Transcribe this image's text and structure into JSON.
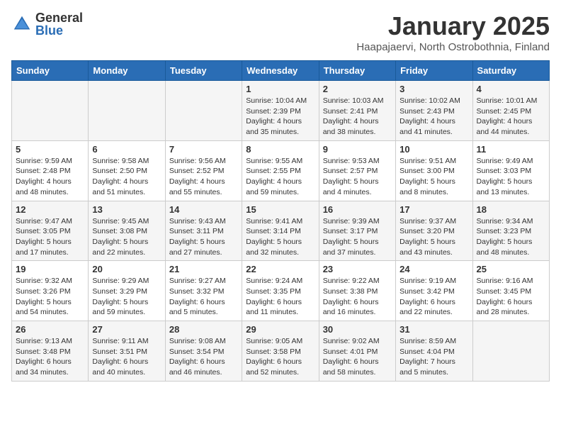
{
  "logo": {
    "general": "General",
    "blue": "Blue"
  },
  "title": "January 2025",
  "subtitle": "Haapajaervi, North Ostrobothnia, Finland",
  "days_of_week": [
    "Sunday",
    "Monday",
    "Tuesday",
    "Wednesday",
    "Thursday",
    "Friday",
    "Saturday"
  ],
  "weeks": [
    [
      {
        "day": "",
        "info": ""
      },
      {
        "day": "",
        "info": ""
      },
      {
        "day": "",
        "info": ""
      },
      {
        "day": "1",
        "info": "Sunrise: 10:04 AM\nSunset: 2:39 PM\nDaylight: 4 hours and 35 minutes."
      },
      {
        "day": "2",
        "info": "Sunrise: 10:03 AM\nSunset: 2:41 PM\nDaylight: 4 hours and 38 minutes."
      },
      {
        "day": "3",
        "info": "Sunrise: 10:02 AM\nSunset: 2:43 PM\nDaylight: 4 hours and 41 minutes."
      },
      {
        "day": "4",
        "info": "Sunrise: 10:01 AM\nSunset: 2:45 PM\nDaylight: 4 hours and 44 minutes."
      }
    ],
    [
      {
        "day": "5",
        "info": "Sunrise: 9:59 AM\nSunset: 2:48 PM\nDaylight: 4 hours and 48 minutes."
      },
      {
        "day": "6",
        "info": "Sunrise: 9:58 AM\nSunset: 2:50 PM\nDaylight: 4 hours and 51 minutes."
      },
      {
        "day": "7",
        "info": "Sunrise: 9:56 AM\nSunset: 2:52 PM\nDaylight: 4 hours and 55 minutes."
      },
      {
        "day": "8",
        "info": "Sunrise: 9:55 AM\nSunset: 2:55 PM\nDaylight: 4 hours and 59 minutes."
      },
      {
        "day": "9",
        "info": "Sunrise: 9:53 AM\nSunset: 2:57 PM\nDaylight: 5 hours and 4 minutes."
      },
      {
        "day": "10",
        "info": "Sunrise: 9:51 AM\nSunset: 3:00 PM\nDaylight: 5 hours and 8 minutes."
      },
      {
        "day": "11",
        "info": "Sunrise: 9:49 AM\nSunset: 3:03 PM\nDaylight: 5 hours and 13 minutes."
      }
    ],
    [
      {
        "day": "12",
        "info": "Sunrise: 9:47 AM\nSunset: 3:05 PM\nDaylight: 5 hours and 17 minutes."
      },
      {
        "day": "13",
        "info": "Sunrise: 9:45 AM\nSunset: 3:08 PM\nDaylight: 5 hours and 22 minutes."
      },
      {
        "day": "14",
        "info": "Sunrise: 9:43 AM\nSunset: 3:11 PM\nDaylight: 5 hours and 27 minutes."
      },
      {
        "day": "15",
        "info": "Sunrise: 9:41 AM\nSunset: 3:14 PM\nDaylight: 5 hours and 32 minutes."
      },
      {
        "day": "16",
        "info": "Sunrise: 9:39 AM\nSunset: 3:17 PM\nDaylight: 5 hours and 37 minutes."
      },
      {
        "day": "17",
        "info": "Sunrise: 9:37 AM\nSunset: 3:20 PM\nDaylight: 5 hours and 43 minutes."
      },
      {
        "day": "18",
        "info": "Sunrise: 9:34 AM\nSunset: 3:23 PM\nDaylight: 5 hours and 48 minutes."
      }
    ],
    [
      {
        "day": "19",
        "info": "Sunrise: 9:32 AM\nSunset: 3:26 PM\nDaylight: 5 hours and 54 minutes."
      },
      {
        "day": "20",
        "info": "Sunrise: 9:29 AM\nSunset: 3:29 PM\nDaylight: 5 hours and 59 minutes."
      },
      {
        "day": "21",
        "info": "Sunrise: 9:27 AM\nSunset: 3:32 PM\nDaylight: 6 hours and 5 minutes."
      },
      {
        "day": "22",
        "info": "Sunrise: 9:24 AM\nSunset: 3:35 PM\nDaylight: 6 hours and 11 minutes."
      },
      {
        "day": "23",
        "info": "Sunrise: 9:22 AM\nSunset: 3:38 PM\nDaylight: 6 hours and 16 minutes."
      },
      {
        "day": "24",
        "info": "Sunrise: 9:19 AM\nSunset: 3:42 PM\nDaylight: 6 hours and 22 minutes."
      },
      {
        "day": "25",
        "info": "Sunrise: 9:16 AM\nSunset: 3:45 PM\nDaylight: 6 hours and 28 minutes."
      }
    ],
    [
      {
        "day": "26",
        "info": "Sunrise: 9:13 AM\nSunset: 3:48 PM\nDaylight: 6 hours and 34 minutes."
      },
      {
        "day": "27",
        "info": "Sunrise: 9:11 AM\nSunset: 3:51 PM\nDaylight: 6 hours and 40 minutes."
      },
      {
        "day": "28",
        "info": "Sunrise: 9:08 AM\nSunset: 3:54 PM\nDaylight: 6 hours and 46 minutes."
      },
      {
        "day": "29",
        "info": "Sunrise: 9:05 AM\nSunset: 3:58 PM\nDaylight: 6 hours and 52 minutes."
      },
      {
        "day": "30",
        "info": "Sunrise: 9:02 AM\nSunset: 4:01 PM\nDaylight: 6 hours and 58 minutes."
      },
      {
        "day": "31",
        "info": "Sunrise: 8:59 AM\nSunset: 4:04 PM\nDaylight: 7 hours and 5 minutes."
      },
      {
        "day": "",
        "info": ""
      }
    ]
  ]
}
